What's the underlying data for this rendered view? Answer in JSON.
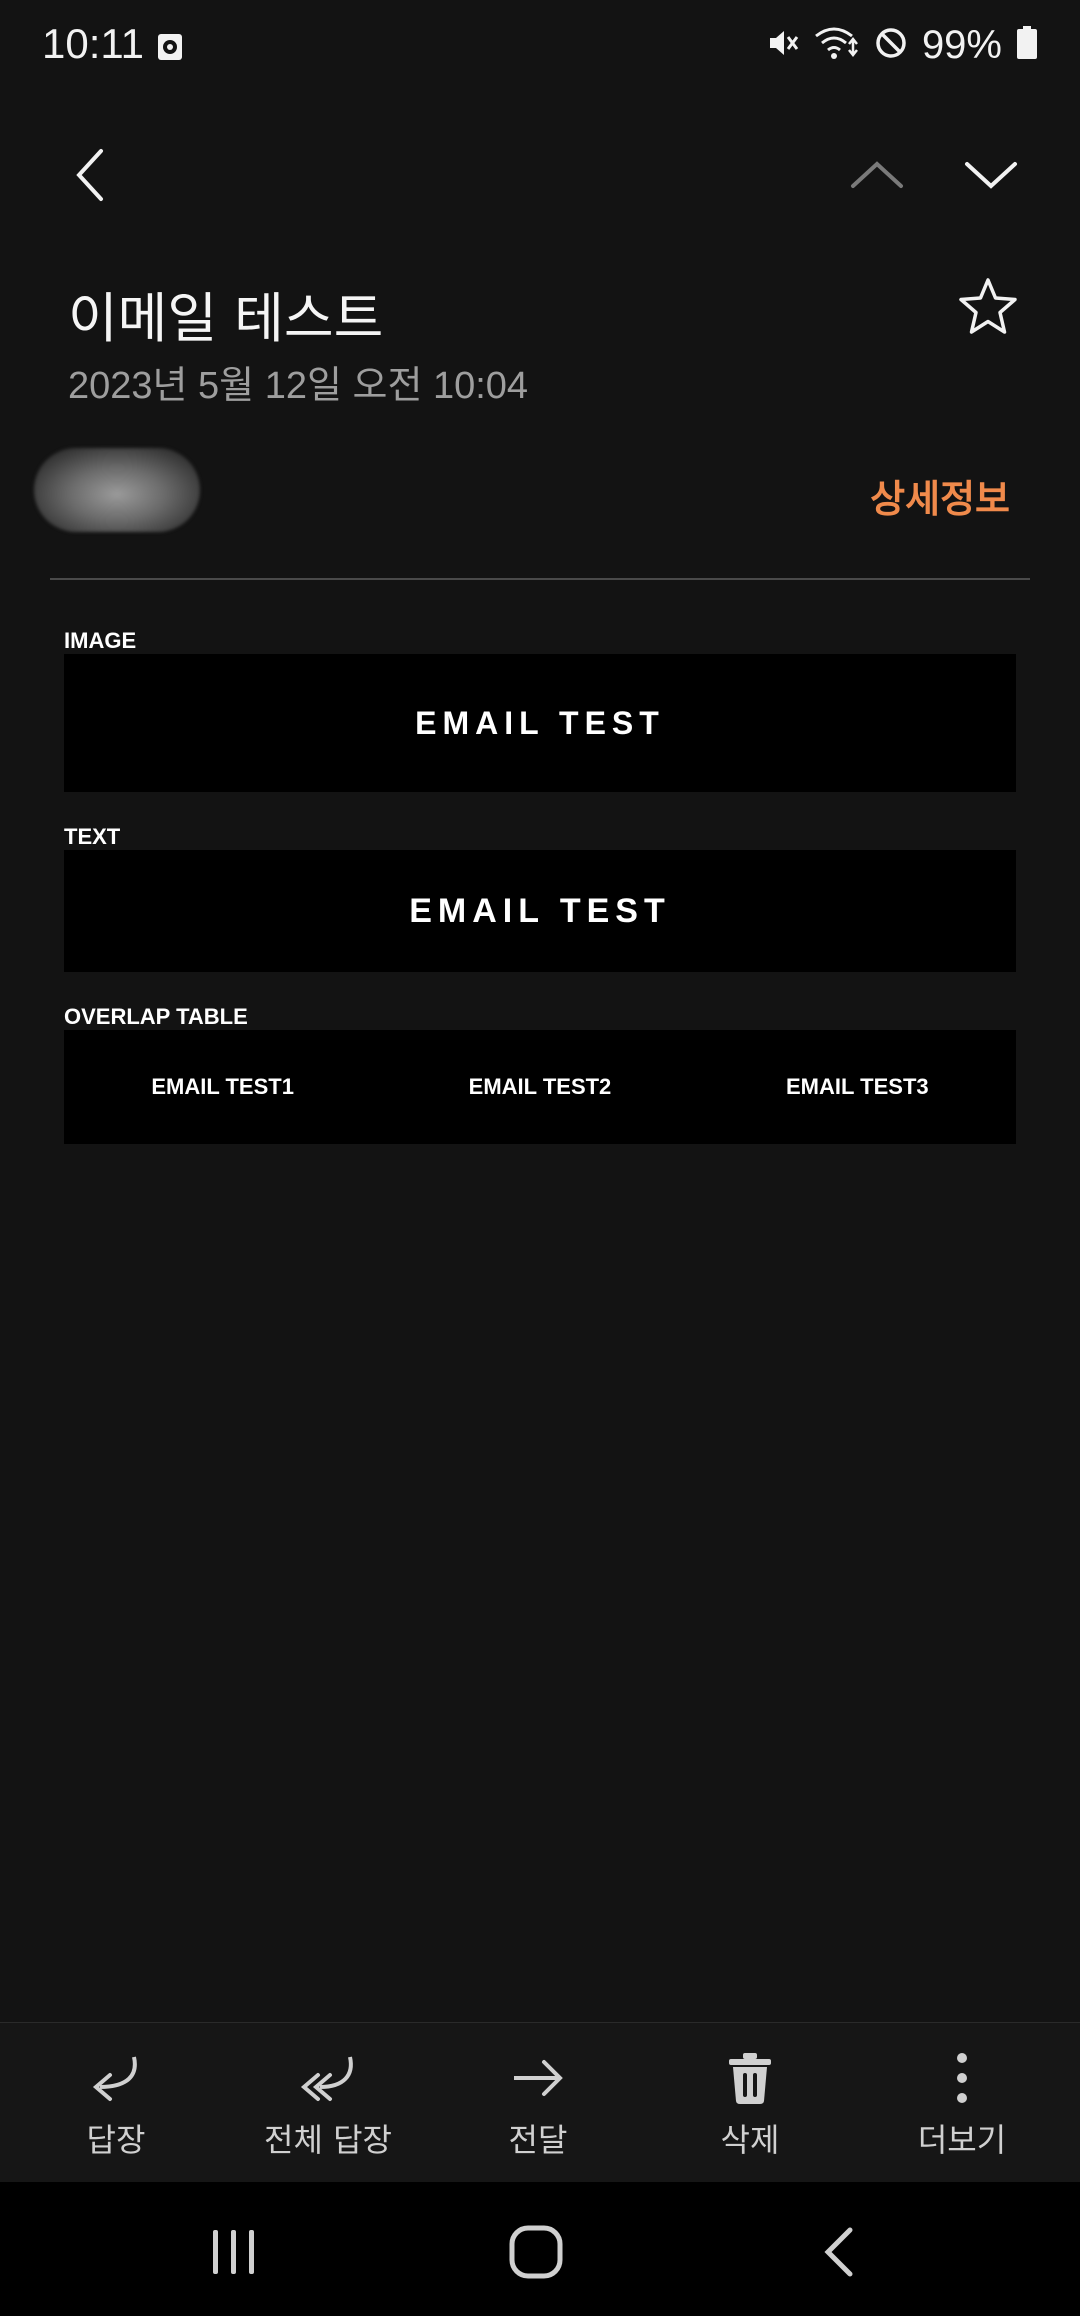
{
  "status": {
    "time": "10:11",
    "battery_pct": "99%"
  },
  "email": {
    "subject": "이메일 테스트",
    "date": "2023년 5월 12일  오전 10:04",
    "details_label": "상세정보"
  },
  "content": {
    "image_label": "IMAGE",
    "image_banner": "EMAIL TEST",
    "text_label": "TEXT",
    "text_banner": "EMAIL TEST",
    "table_label": "OVERLAP TABLE",
    "table_cells": [
      "EMAIL TEST1",
      "EMAIL TEST2",
      "EMAIL TEST3"
    ]
  },
  "toolbar": {
    "reply": "답장",
    "reply_all": "전체 답장",
    "forward": "전달",
    "delete": "삭제",
    "more": "더보기"
  },
  "colors": {
    "accent": "#f08a4b",
    "background": "#131313"
  }
}
